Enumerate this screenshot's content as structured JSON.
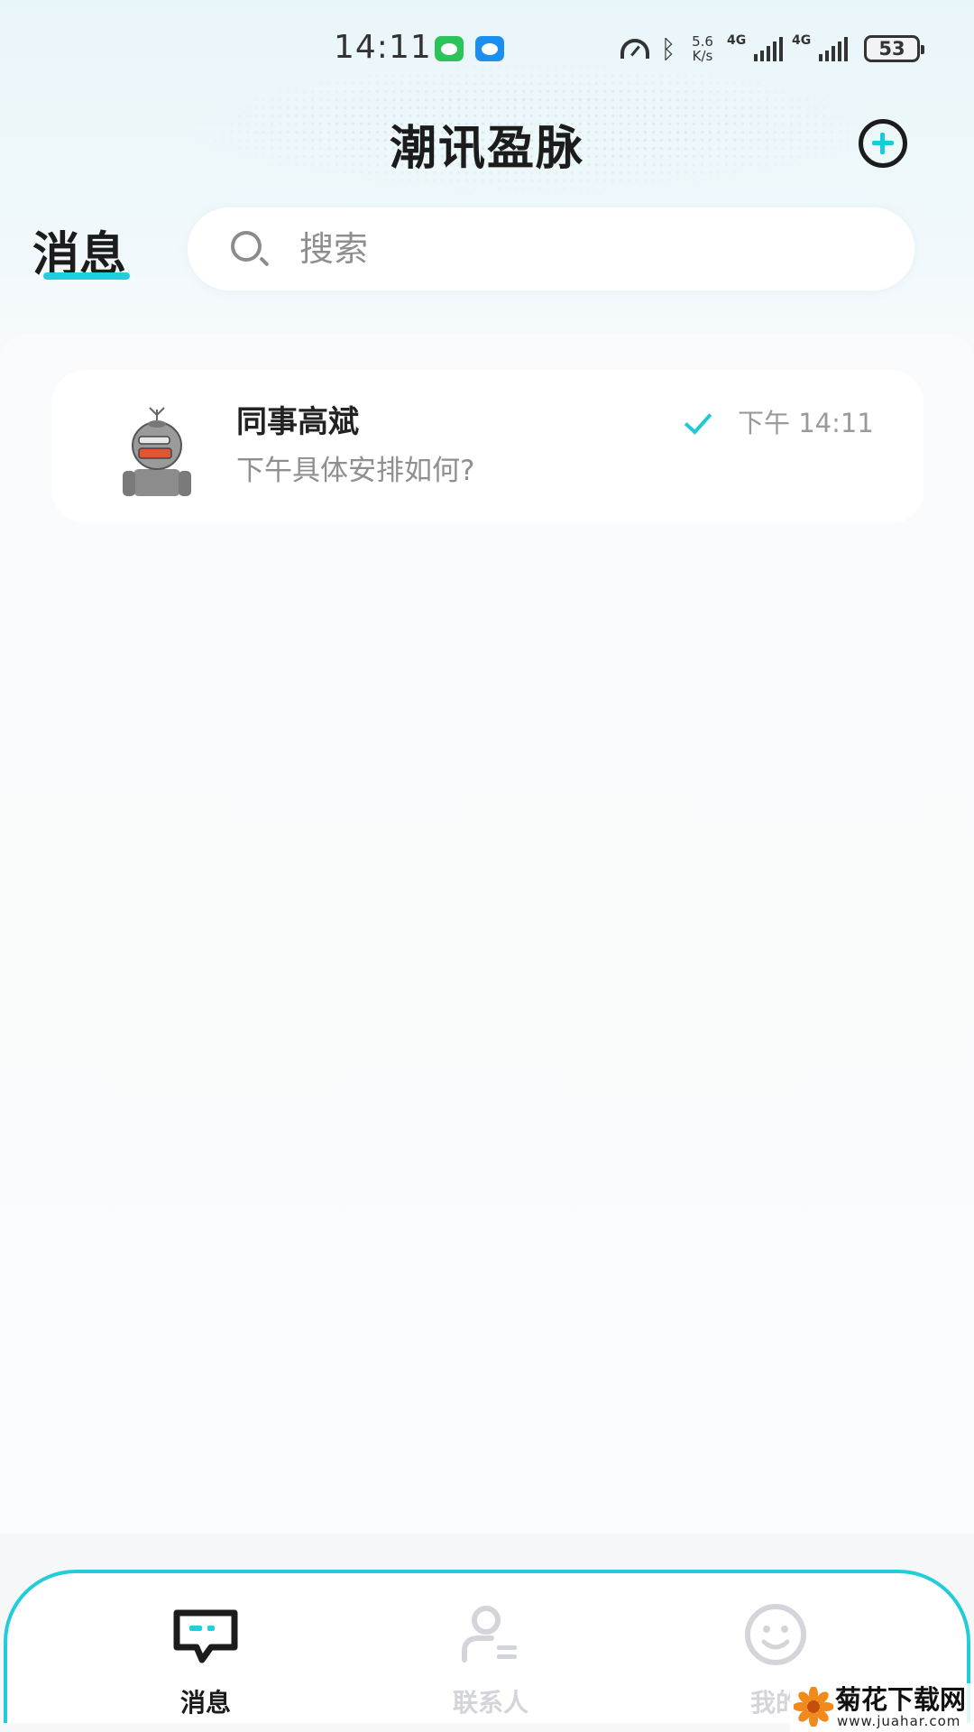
{
  "status_bar": {
    "time": "14:11",
    "net_speed_value": "5.6",
    "net_speed_unit": "K/s",
    "signal1_label": "4G",
    "signal2_label": "4G",
    "battery": "53",
    "notification_icons": [
      "wechat-icon",
      "message-icon"
    ]
  },
  "header": {
    "title": "潮讯盈脉",
    "add_icon": "plus-circle-icon"
  },
  "section": {
    "title": "消息"
  },
  "search": {
    "placeholder": "搜索",
    "icon": "search-icon"
  },
  "conversations": [
    {
      "name": "同事高斌",
      "preview": "下午具体安排如何?",
      "time": "下午 14:11",
      "status_icon": "read-check-icon"
    }
  ],
  "tabs": [
    {
      "label": "消息",
      "icon": "chat-bubble-icon",
      "active": true
    },
    {
      "label": "联系人",
      "icon": "contacts-icon",
      "active": false
    },
    {
      "label": "我的",
      "icon": "smiley-icon",
      "active": false
    }
  ],
  "watermark": {
    "title": "菊花下载网",
    "url": "www.juahar.com"
  },
  "colors": {
    "accent": "#1fd0dc",
    "text_primary": "#1c1c1c",
    "text_secondary": "#8f8f8f",
    "tab_inactive": "#d4d5da"
  }
}
